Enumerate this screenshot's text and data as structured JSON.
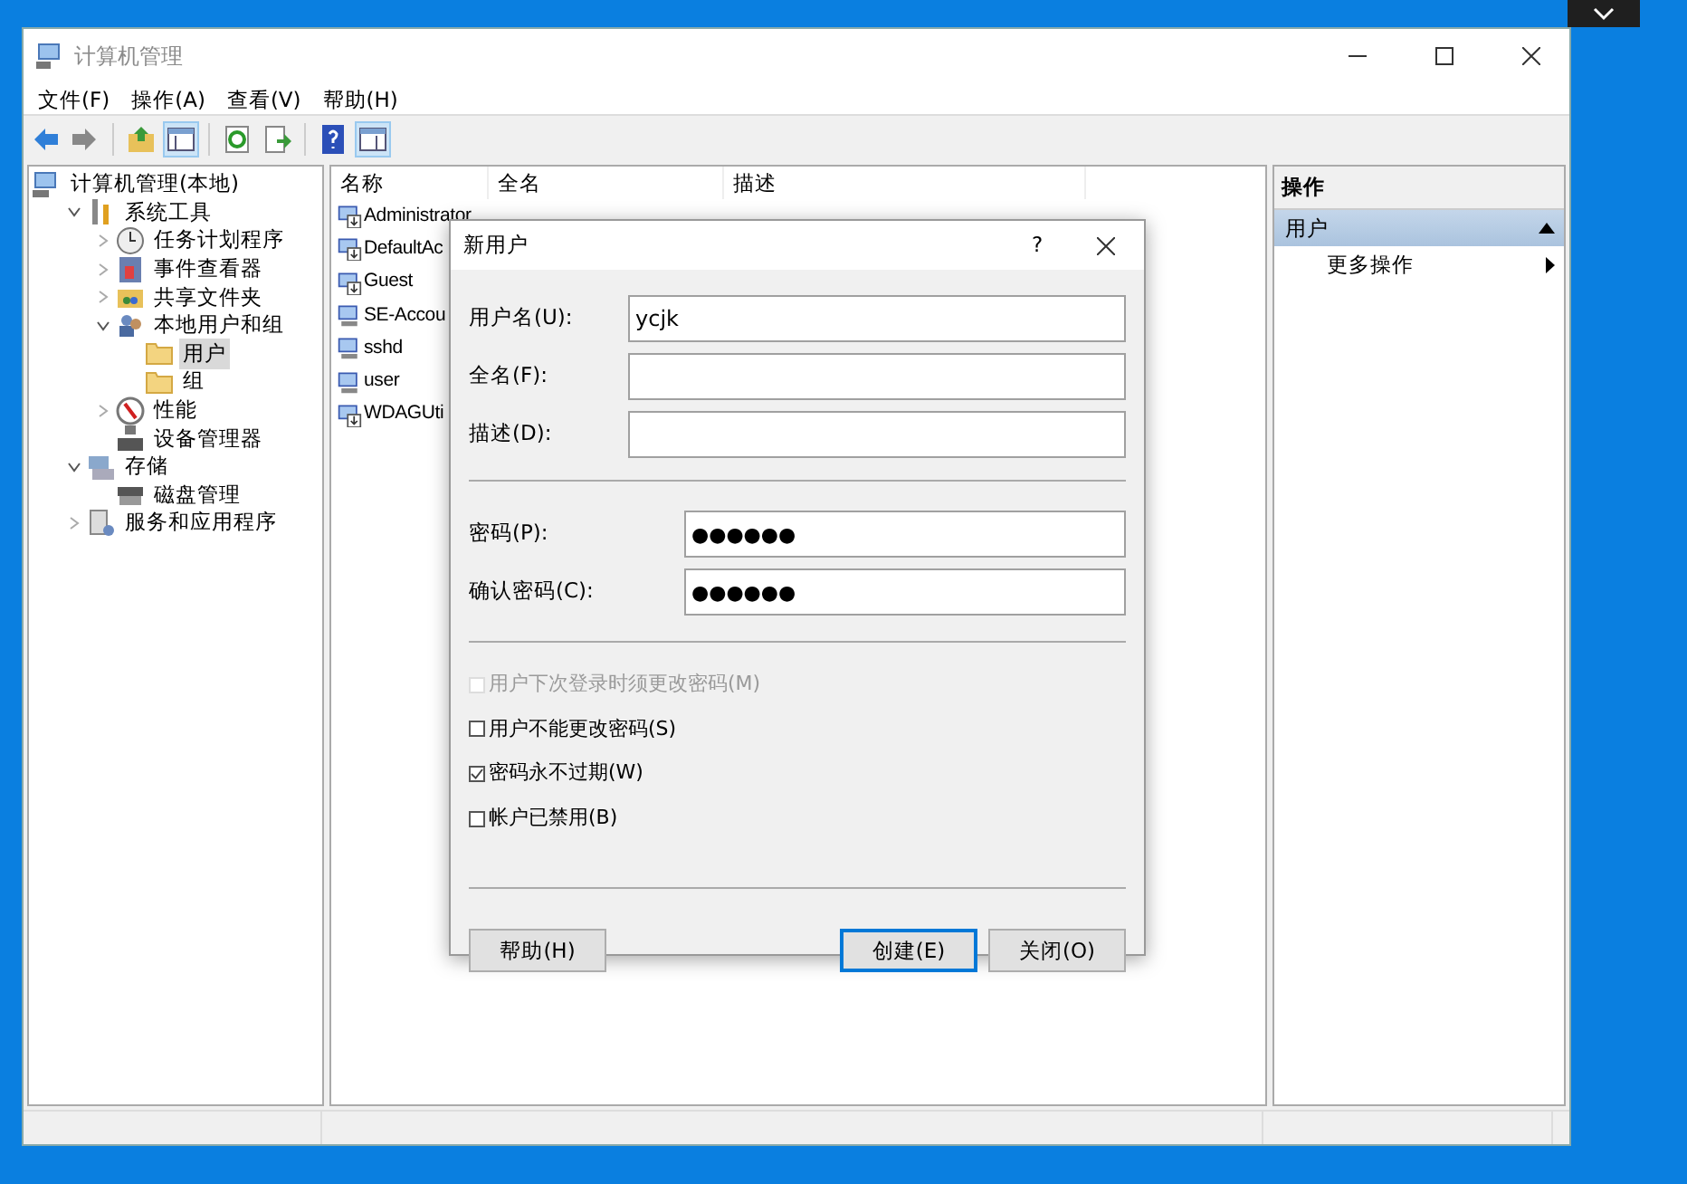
{
  "window": {
    "title": "计算机管理"
  },
  "menu": [
    "文件(F)",
    "操作(A)",
    "查看(V)",
    "帮助(H)"
  ],
  "toolbar": [
    {
      "kind": "back",
      "pressed": false
    },
    {
      "kind": "forward",
      "pressed": false
    },
    {
      "kind": "sep"
    },
    {
      "kind": "up",
      "pressed": false
    },
    {
      "kind": "tree",
      "pressed": true
    },
    {
      "kind": "sep"
    },
    {
      "kind": "refresh",
      "pressed": false
    },
    {
      "kind": "export",
      "pressed": false
    },
    {
      "kind": "sep"
    },
    {
      "kind": "help",
      "pressed": false
    },
    {
      "kind": "pane",
      "pressed": true
    }
  ],
  "tree": [
    {
      "label": "计算机管理(本地)",
      "selected": false,
      "children": [
        {
          "label": "系统工具",
          "expanded": true,
          "selected": false,
          "children": [
            {
              "label": "任务计划程序",
              "expanded": false,
              "selected": false
            },
            {
              "label": "事件查看器",
              "expanded": false,
              "selected": false
            },
            {
              "label": "共享文件夹",
              "expanded": false,
              "selected": false
            },
            {
              "label": "本地用户和组",
              "expanded": true,
              "selected": false,
              "children": [
                {
                  "label": "用户",
                  "selected": true
                },
                {
                  "label": "组",
                  "selected": false
                }
              ]
            },
            {
              "label": "性能",
              "expanded": false,
              "selected": false
            },
            {
              "label": "设备管理器",
              "selected": false
            }
          ]
        },
        {
          "label": "存储",
          "expanded": true,
          "selected": false,
          "children": [
            {
              "label": "磁盘管理",
              "selected": false
            }
          ]
        },
        {
          "label": "服务和应用程序",
          "expanded": false,
          "selected": false
        }
      ]
    }
  ],
  "list": {
    "columns": [
      "名称",
      "全名",
      "描述"
    ],
    "rows": [
      {
        "name": "Administrator"
      },
      {
        "name": "DefaultAc"
      },
      {
        "name": "Guest"
      },
      {
        "name": "SE-Accou"
      },
      {
        "name": "sshd"
      },
      {
        "name": "user"
      },
      {
        "name": "WDAGUti"
      }
    ]
  },
  "actions": {
    "header": "操作",
    "section": "用户",
    "items": [
      "更多操作"
    ]
  },
  "dialog": {
    "title": "新用户",
    "help_glyph": "?",
    "fields": [
      {
        "label": "用户名(U):",
        "value": "ycjk",
        "kind": "wide"
      },
      {
        "label": "全名(F):",
        "kind": "wide"
      },
      {
        "label": "描述(D):",
        "kind": "wide"
      },
      {
        "kind": "rule"
      },
      {
        "label": "密码(P):",
        "value": "●●●●●●",
        "kind": "narrow"
      },
      {
        "label": "确认密码(C):",
        "value": "●●●●●●",
        "kind": "narrow"
      }
    ],
    "checkboxes": [
      {
        "label": "用户下次登录时须更改密码(M)",
        "checked": false,
        "disabled": true
      },
      {
        "label": "用户不能更改密码(S)",
        "checked": false,
        "disabled": false
      },
      {
        "label": "密码永不过期(W)",
        "checked": true,
        "disabled": false
      },
      {
        "label": "帐户已禁用(B)",
        "checked": false,
        "disabled": false
      }
    ],
    "buttons": [
      {
        "label": "帮助(H)",
        "default": false
      },
      {
        "label": "创建(E)",
        "default": true
      },
      {
        "label": "关闭(O)",
        "default": false
      }
    ]
  }
}
